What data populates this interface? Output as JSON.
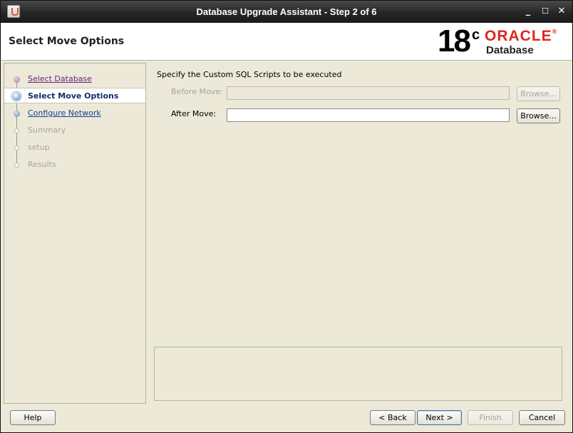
{
  "window": {
    "title": "Database Upgrade Assistant - Step 2 of 6",
    "minimize_glyph": "_",
    "maximize_glyph": "☐",
    "close_glyph": "✕"
  },
  "header": {
    "page_title": "Select Move Options",
    "logo": {
      "version": "18",
      "version_suffix": "c",
      "brand": "ORACLE",
      "brand_suffix": "®",
      "product": "Database"
    }
  },
  "nav": {
    "items": [
      {
        "label": "Select Database",
        "state": "visited"
      },
      {
        "label": "Select Move Options",
        "state": "current"
      },
      {
        "label": "Configure Network",
        "state": "link"
      },
      {
        "label": "Summary",
        "state": "disabled"
      },
      {
        "label": "setup",
        "state": "disabled"
      },
      {
        "label": "Results",
        "state": "disabled"
      }
    ]
  },
  "content": {
    "section_label": "Specify the Custom SQL Scripts to be executed",
    "before_move": {
      "label": "Before Move:",
      "value": "",
      "browse_label": "Browse...",
      "enabled": false
    },
    "after_move": {
      "label": "After Move:",
      "value": "",
      "browse_label": "Browse...",
      "enabled": true
    },
    "message": ""
  },
  "footer": {
    "help_label": "Help",
    "back_label": "< Back",
    "next_label": "Next >",
    "finish_label": "Finish",
    "cancel_label": "Cancel"
  },
  "colors": {
    "background": "#ece9d8",
    "oracle_red": "#e0261d",
    "visited_link": "#6b1f7a",
    "link": "#183e8f",
    "disabled_text": "#a8a597"
  }
}
